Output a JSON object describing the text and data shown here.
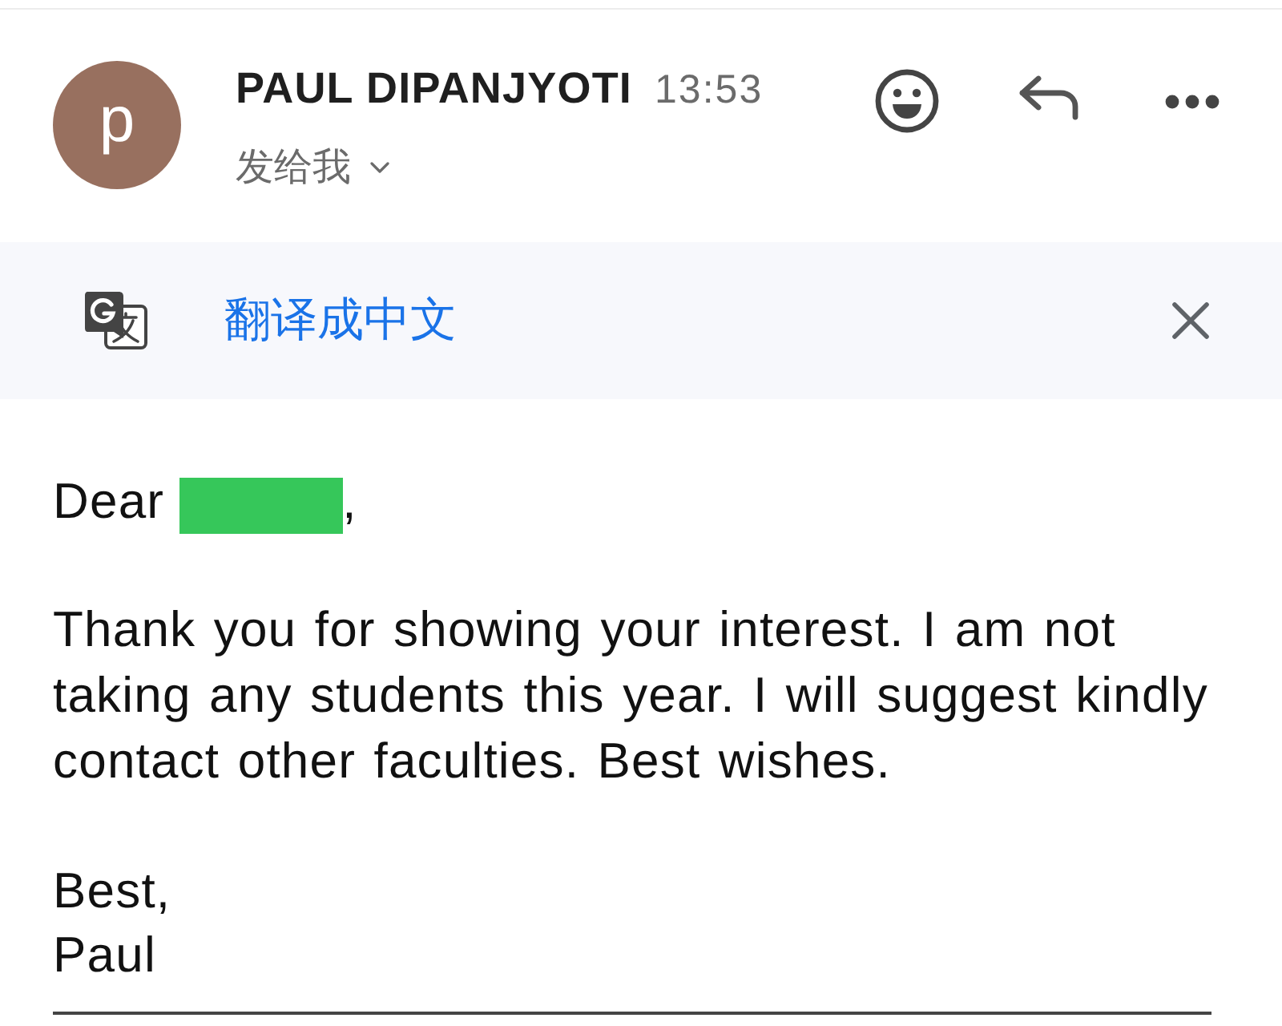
{
  "header": {
    "avatar_initial": "p",
    "sender_name": "PAUL DIPANJYOTI",
    "time": "13:53",
    "recipient": "发给我"
  },
  "translate_bar": {
    "label": "翻译成中文"
  },
  "message": {
    "greeting": "Dear",
    "greeting_end": ",",
    "paragraph": "Thank you for showing your interest. I am not taking any students this year. I will suggest kindly contact other faculties. Best wishes.",
    "sign_off": "Best,",
    "signature": "Paul"
  }
}
